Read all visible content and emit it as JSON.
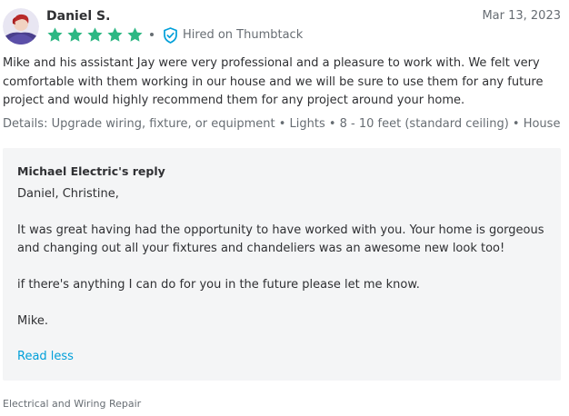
{
  "review": {
    "reviewer_name": "Daniel S.",
    "date": "Mar 13, 2023",
    "rating": 5,
    "rating_max": 5,
    "hired_label": "Hired on Thumbtack",
    "text": "Mike and his assistant Jay were very professional and a pleasure to work with. We felt very comfortable with them working in our house and we will be sure to use them for any future project and would highly recommend them for any project around your home.",
    "details": "Details: Upgrade wiring, fixture, or equipment • Lights • 8 - 10 feet (standard ceiling) • House"
  },
  "reply": {
    "title": "Michael Electric's reply",
    "greeting": "Daniel, Christine,",
    "paragraph_1": "It was great having had the opportunity to have worked with you. Your home is gorgeous and changing out all your fixtures and chandeliers was an awesome new look too!",
    "paragraph_2": "if there's anything I can do for you in the future please let me know.",
    "signoff": "Mike.",
    "read_less_label": "Read less"
  },
  "footer": {
    "category": "Electrical and Wiring Repair"
  },
  "colors": {
    "star_green": "#2db783",
    "link_blue": "#009fd9",
    "verified_teal": "#009fd9",
    "reply_bg": "#f4f5f6",
    "muted_text": "#676d73"
  },
  "icons": {
    "avatar": "avatar-icon",
    "star": "star-icon",
    "hired": "shield-check-icon"
  }
}
